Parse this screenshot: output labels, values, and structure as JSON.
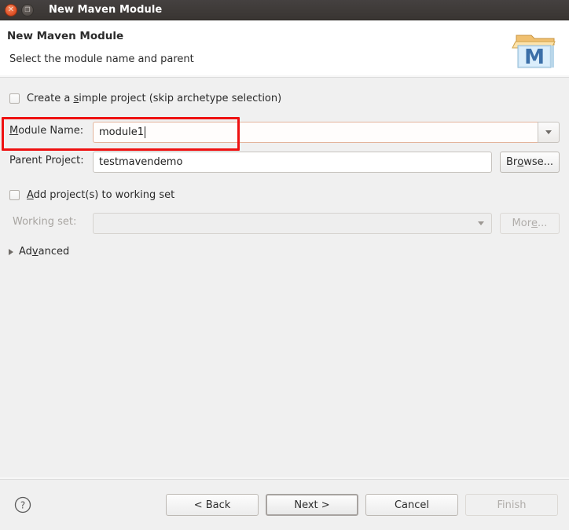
{
  "window": {
    "title": "New Maven Module",
    "controls": [
      {
        "name": "close-button",
        "icon": "close-icon",
        "glyph": "✕"
      },
      {
        "name": "maximize-button",
        "icon": "maximize-icon",
        "glyph": "❐"
      }
    ]
  },
  "header": {
    "title": "New Maven Module",
    "subtitle": "Select the module name and parent",
    "icon": "maven-module-icon"
  },
  "form": {
    "simple_project": {
      "label_pre": "Create a ",
      "label_mnemonic": "s",
      "label_post": "imple project (skip archetype selection)",
      "checked": false
    },
    "module_name": {
      "label_mnemonic": "M",
      "label_post": "odule Name:",
      "value": "module1",
      "dropdown_icon": "chevron-down-icon"
    },
    "parent_project": {
      "label": "Parent Project:",
      "value": "testmavendemo",
      "browse_pre": "Br",
      "browse_mnemonic": "o",
      "browse_post": "wse..."
    },
    "working_set_checkbox": {
      "label_mnemonic": "A",
      "label_post": "dd project(s) to working set",
      "checked": false
    },
    "working_set": {
      "label": "Working set:",
      "value": "",
      "more_pre": "Mor",
      "more_mnemonic": "e",
      "more_post": "...",
      "dropdown_icon": "chevron-down-icon",
      "disabled": true
    },
    "advanced": {
      "label_pre": "Ad",
      "label_mnemonic": "v",
      "label_post": "anced",
      "expanded": false,
      "icon": "disclosure-triangle-icon"
    }
  },
  "footer": {
    "help_icon": "help-question-icon",
    "buttons": [
      {
        "name": "back-button",
        "label": "< Back",
        "disabled": false,
        "default": false
      },
      {
        "name": "next-button",
        "label": "Next >",
        "disabled": false,
        "default": true
      },
      {
        "name": "cancel-button",
        "label": "Cancel",
        "disabled": false,
        "default": false
      },
      {
        "name": "finish-button",
        "label": "Finish",
        "disabled": true,
        "default": false
      }
    ]
  },
  "annotation": {
    "color": "#ee1111",
    "target": "module-name-row"
  }
}
